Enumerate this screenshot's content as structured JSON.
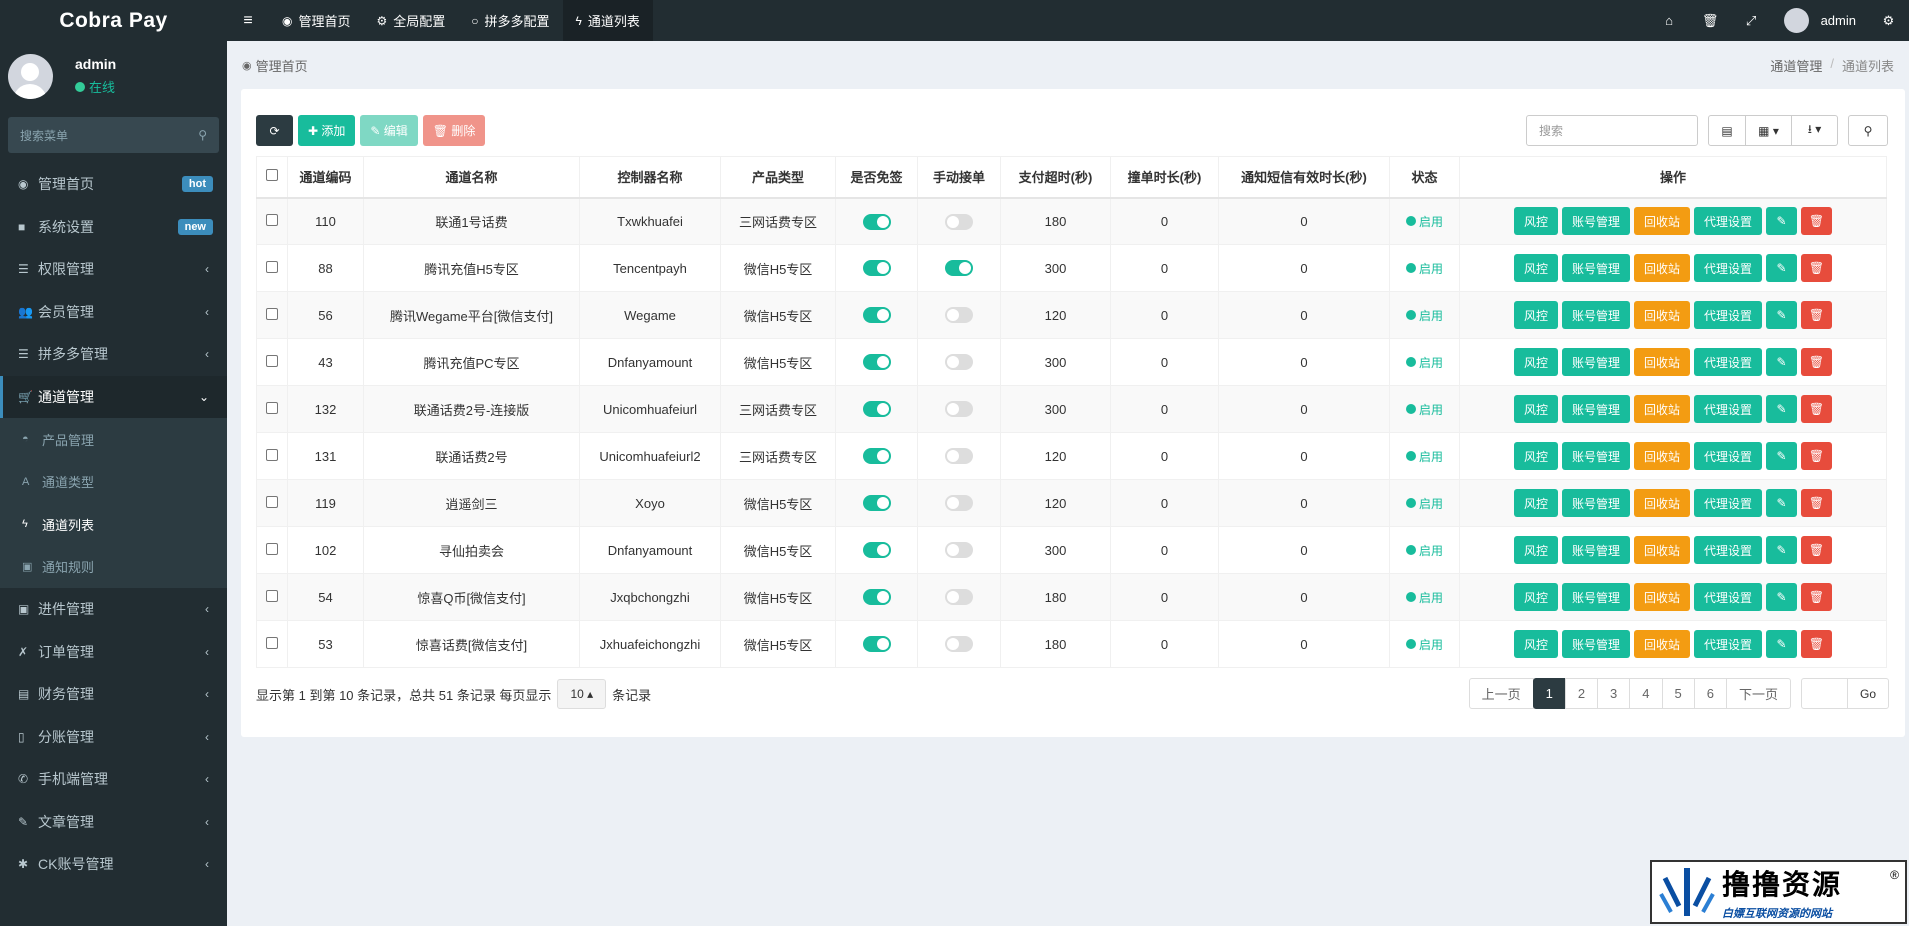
{
  "app": {
    "logo": "Cobra Pay"
  },
  "user": {
    "name": "admin",
    "status": "在线"
  },
  "side_search": {
    "placeholder": "搜索菜单"
  },
  "menu": [
    {
      "icon": "dashboard-icon",
      "glyph": "◉",
      "label": "管理首页",
      "badge": "hot",
      "arrow": ""
    },
    {
      "icon": "folder-icon",
      "glyph": "■",
      "label": "系统设置",
      "badge": "new",
      "arrow": ""
    },
    {
      "icon": "list-icon",
      "glyph": "☰",
      "label": "权限管理",
      "badge": "",
      "arrow": "‹"
    },
    {
      "icon": "users-icon",
      "glyph": "👥",
      "label": "会员管理",
      "badge": "",
      "arrow": "‹"
    },
    {
      "icon": "list-icon",
      "glyph": "☰",
      "label": "拼多多管理",
      "badge": "",
      "arrow": "‹"
    }
  ],
  "channel_menu": {
    "icon": "cart-icon",
    "glyph": "🛒",
    "label": "通道管理",
    "arrow": "⌄"
  },
  "submenu": [
    {
      "icon": "gauge-icon",
      "glyph": "◓",
      "label": "产品管理"
    },
    {
      "icon": "font-icon",
      "glyph": "A",
      "label": "通道类型"
    },
    {
      "icon": "bolt-icon",
      "glyph": "ϟ",
      "label": "通道列表"
    },
    {
      "icon": "rule-icon",
      "glyph": "▣",
      "label": "通知规则"
    }
  ],
  "menu2": [
    {
      "icon": "box-icon",
      "glyph": "▣",
      "label": "进件管理",
      "arrow": "‹"
    },
    {
      "icon": "order-icon",
      "glyph": "✗",
      "label": "订单管理",
      "arrow": "‹"
    },
    {
      "icon": "finance-icon",
      "glyph": "▤",
      "label": "财务管理",
      "arrow": "‹"
    },
    {
      "icon": "split-icon",
      "glyph": "▯",
      "label": "分账管理",
      "arrow": "‹"
    },
    {
      "icon": "phone-icon",
      "glyph": "✆",
      "label": "手机端管理",
      "arrow": "‹"
    },
    {
      "icon": "brush-icon",
      "glyph": "✎",
      "label": "文章管理",
      "arrow": "‹"
    },
    {
      "icon": "bug-icon",
      "glyph": "✱",
      "label": "CK账号管理",
      "arrow": "‹"
    }
  ],
  "navbar": {
    "toggle": "≡",
    "links": [
      {
        "icon": "dashboard-icon",
        "glyph": "◉",
        "label": "管理首页"
      },
      {
        "icon": "cogs-icon",
        "glyph": "⚙",
        "label": "全局配置"
      },
      {
        "icon": "circle-icon",
        "glyph": "○",
        "label": "拼多多配置"
      },
      {
        "icon": "bolt-icon",
        "glyph": "ϟ",
        "label": "通道列表"
      }
    ],
    "right_icons": [
      {
        "icon": "home-icon",
        "glyph": "⌂"
      },
      {
        "icon": "trash-icon",
        "glyph": "🗑"
      },
      {
        "icon": "fullscreen-icon",
        "glyph": "⤢"
      }
    ],
    "user": "admin",
    "settings_icon": "⚙"
  },
  "content_header": {
    "title": "管理首页",
    "breadcrumb": [
      "通道管理",
      "通道列表"
    ]
  },
  "toolbar": {
    "refresh": "⟳",
    "add": "✚ 添加",
    "edit": "✎ 编辑",
    "delete": "🗑 删除",
    "search_placeholder": "搜索",
    "view_icon": "▤",
    "columns_icon": "▦ ▾",
    "export_icon": "⭳ ▾",
    "search_icon": "⚲"
  },
  "table": {
    "headers": [
      "通道编码",
      "通道名称",
      "控制器名称",
      "产品类型",
      "是否免签",
      "手动接单",
      "支付超时(秒)",
      "撞单时长(秒)",
      "通知短信有效时长(秒)",
      "状态",
      "操作"
    ],
    "rows": [
      {
        "id": "110",
        "name": "联通1号话费",
        "controller": "Txwkhuafei",
        "product": "三网话费专区",
        "free_sign": true,
        "manual": false,
        "timeout": "180",
        "collision": "0",
        "sms": "0",
        "status": "启用"
      },
      {
        "id": "88",
        "name": "腾讯充值H5专区",
        "controller": "Tencentpayh",
        "product": "微信H5专区",
        "free_sign": true,
        "manual": true,
        "timeout": "300",
        "collision": "0",
        "sms": "0",
        "status": "启用"
      },
      {
        "id": "56",
        "name": "腾讯Wegame平台[微信支付]",
        "controller": "Wegame",
        "product": "微信H5专区",
        "free_sign": true,
        "manual": false,
        "timeout": "120",
        "collision": "0",
        "sms": "0",
        "status": "启用"
      },
      {
        "id": "43",
        "name": "腾讯充值PC专区",
        "controller": "Dnfanyamount",
        "product": "微信H5专区",
        "free_sign": true,
        "manual": false,
        "timeout": "300",
        "collision": "0",
        "sms": "0",
        "status": "启用"
      },
      {
        "id": "132",
        "name": "联通话费2号-连接版",
        "controller": "Unicomhuafeiurl",
        "product": "三网话费专区",
        "free_sign": true,
        "manual": false,
        "timeout": "300",
        "collision": "0",
        "sms": "0",
        "status": "启用"
      },
      {
        "id": "131",
        "name": "联通话费2号",
        "controller": "Unicomhuafeiurl2",
        "product": "三网话费专区",
        "free_sign": true,
        "manual": false,
        "timeout": "120",
        "collision": "0",
        "sms": "0",
        "status": "启用"
      },
      {
        "id": "119",
        "name": "逍遥剑三",
        "controller": "Xoyo",
        "product": "微信H5专区",
        "free_sign": true,
        "manual": false,
        "timeout": "120",
        "collision": "0",
        "sms": "0",
        "status": "启用"
      },
      {
        "id": "102",
        "name": "寻仙拍卖会",
        "controller": "Dnfanyamount",
        "product": "微信H5专区",
        "free_sign": true,
        "manual": false,
        "timeout": "300",
        "collision": "0",
        "sms": "0",
        "status": "启用"
      },
      {
        "id": "54",
        "name": "惊喜Q币[微信支付]",
        "controller": "Jxqbchongzhi",
        "product": "微信H5专区",
        "free_sign": true,
        "manual": false,
        "timeout": "180",
        "collision": "0",
        "sms": "0",
        "status": "启用"
      },
      {
        "id": "53",
        "name": "惊喜话费[微信支付]",
        "controller": "Jxhuafeichongzhi",
        "product": "微信H5专区",
        "free_sign": true,
        "manual": false,
        "timeout": "180",
        "collision": "0",
        "sms": "0",
        "status": "启用"
      }
    ],
    "ops": {
      "risk": "风控",
      "account": "账号管理",
      "recycle": "回收站",
      "agent": "代理设置",
      "edit": "✎",
      "delete": "🗑"
    }
  },
  "pager": {
    "info_prefix": "显示第 1 到第 10 条记录，总共 51 条记录 每页显示",
    "page_size": "10 ▴",
    "info_suffix": "条记录",
    "prev": "上一页",
    "pages": [
      "1",
      "2",
      "3",
      "4",
      "5",
      "6"
    ],
    "next": "下一页",
    "go": "Go"
  },
  "watermark": {
    "title": "撸撸资源",
    "subtitle": "白嫖互联网资源的网站",
    "reg": "®"
  },
  "colors": {
    "sidebar": "#222d32",
    "accent": "#18bc9c",
    "orange": "#f39c12",
    "red": "#e74c3c",
    "badge": "#3c8dbc"
  }
}
